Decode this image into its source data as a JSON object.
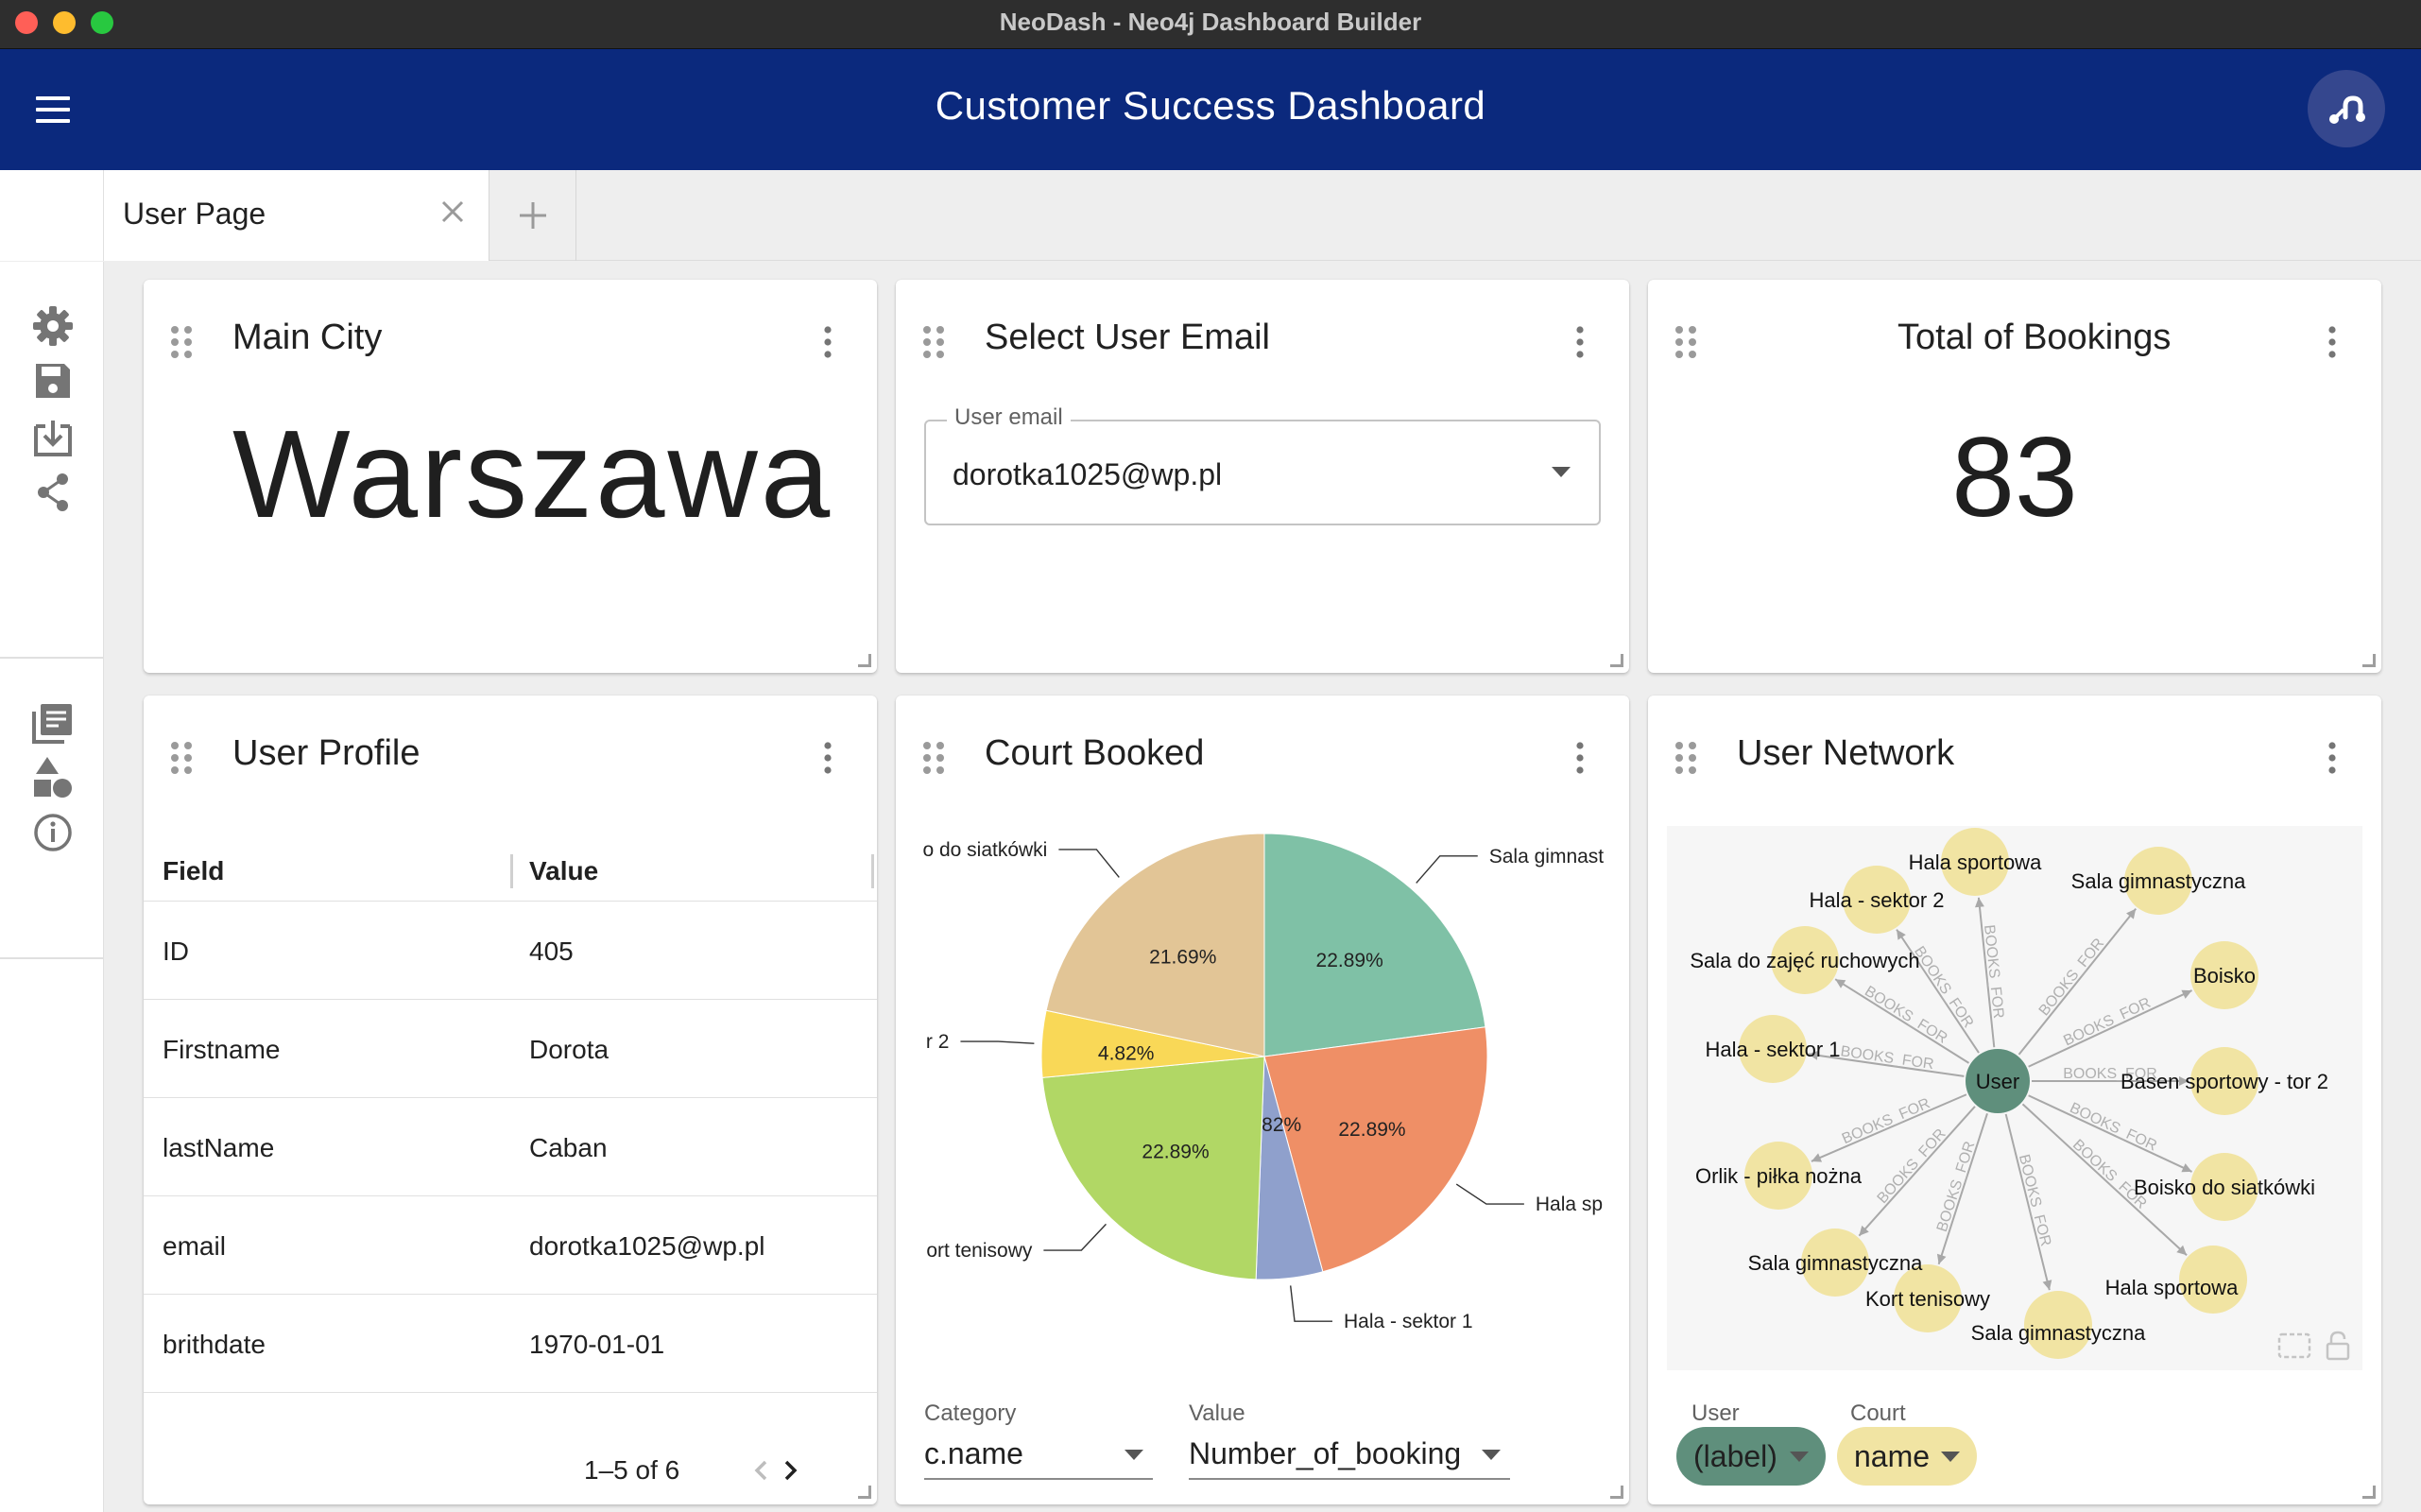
{
  "window": {
    "title": "NeoDash - Neo4j Dashboard Builder"
  },
  "header": {
    "title": "Customer Success Dashboard"
  },
  "tabs": [
    {
      "label": "User Page"
    }
  ],
  "sidebar": {
    "items": [
      {
        "icon": "gear-icon"
      },
      {
        "icon": "save-icon"
      },
      {
        "icon": "download-icon"
      },
      {
        "icon": "share-icon"
      },
      {
        "icon": "library-icon"
      },
      {
        "icon": "shapes-icon"
      },
      {
        "icon": "info-icon"
      }
    ]
  },
  "cards": {
    "main_city": {
      "title": "Main City",
      "value": "Warszawa"
    },
    "select_email": {
      "title": "Select User Email",
      "label": "User email",
      "value": "dorotka1025@wp.pl"
    },
    "total_bookings": {
      "title": "Total of Bookings",
      "value": "83"
    },
    "user_profile": {
      "title": "User Profile",
      "columns": [
        "Field",
        "Value"
      ],
      "rows": [
        {
          "field": "ID",
          "value": "405"
        },
        {
          "field": "Firstname",
          "value": "Dorota"
        },
        {
          "field": "lastName",
          "value": "Caban"
        },
        {
          "field": "email",
          "value": "dorotka1025@wp.pl"
        },
        {
          "field": "brithdate",
          "value": "1970-01-01"
        }
      ],
      "pagination": "1–5 of 6"
    },
    "court_booked": {
      "title": "Court Booked",
      "category_label": "Category",
      "category_value": "c.name",
      "value_label": "Value",
      "value_value": "Number_of_booking"
    },
    "user_network": {
      "title": "User Network",
      "center_node": "User",
      "edge_label": "BOOKS_FOR",
      "nodes": [
        "Hala sportowa",
        "Sala gimnastyczna",
        "Boisko",
        "Basen sportowy - tor 2",
        "Boisko do siatkówki",
        "Hala sportowa",
        "Sala gimnastyczna",
        "Kort tenisowy",
        "Sala gimnastyczna",
        "Orlik - piłka nożna",
        "Hala - sektor 1",
        "Sala do zajęć ruchowych",
        "Hala - sektor 2"
      ],
      "legend": [
        {
          "label": "User",
          "value": "(label)",
          "color": "#5f8f7c"
        },
        {
          "label": "Court",
          "value": "name",
          "color": "#f1e4a3"
        }
      ]
    }
  },
  "chart_data": {
    "type": "pie",
    "slices": [
      {
        "label": "Sala gimnast",
        "value": 22.89,
        "text": "22.89%",
        "color": "#7fc1a6"
      },
      {
        "label": "Hala sp",
        "value": 22.89,
        "text": "22.89%",
        "color": "#ef8f66"
      },
      {
        "label": "Hala - sektor 1",
        "value": 4.82,
        "text": "4.82%",
        "color": "#8fa0cc"
      },
      {
        "label": "ort tenisowy",
        "value": 22.89,
        "text": "22.89%",
        "color": "#b1d765"
      },
      {
        "label": "r 2",
        "value": 4.82,
        "text": "4.82%",
        "color": "#f9d857"
      },
      {
        "label": "o do siatkówki",
        "value": 21.69,
        "text": "21.69%",
        "color": "#e2c596"
      }
    ]
  }
}
